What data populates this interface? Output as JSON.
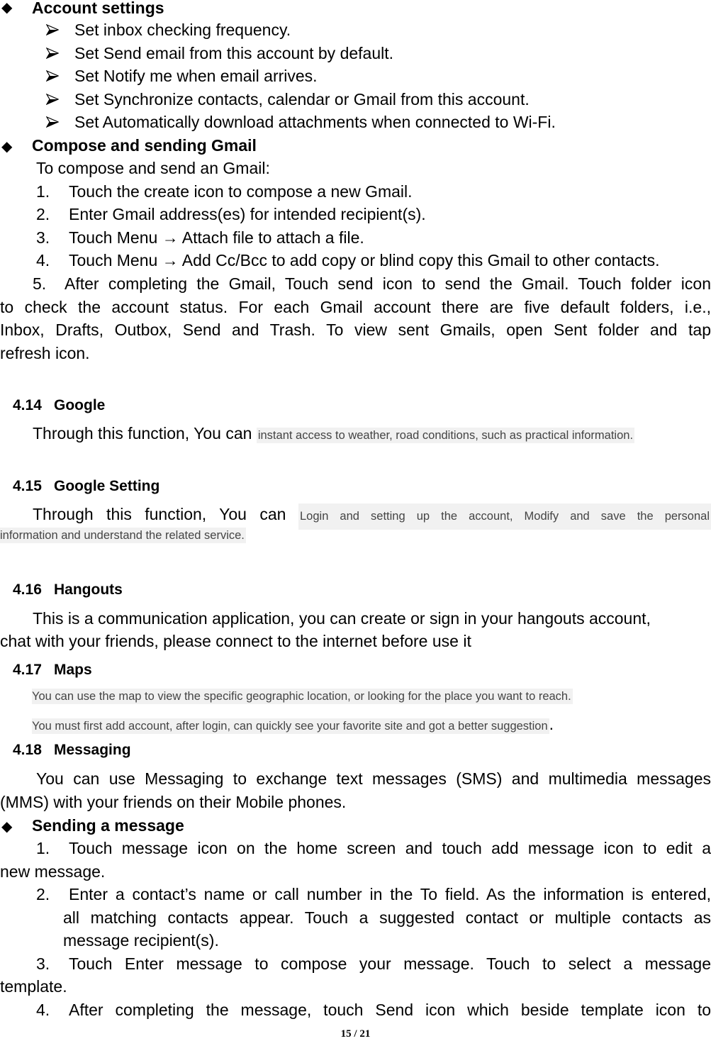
{
  "account_settings": {
    "title": "Account settings",
    "items": [
      "Set inbox checking frequency.",
      "Set Send email from this account by default.",
      "Set Notify me when email arrives.",
      "Set Synchronize contacts, calendar or Gmail from this account.",
      "Set Automatically download attachments when connected to Wi-Fi."
    ]
  },
  "compose": {
    "title": "Compose and sending Gmail",
    "intro": "To compose and send an Gmail:",
    "steps": [
      {
        "num": "1.",
        "text": "Touch the create icon to compose a new Gmail."
      },
      {
        "num": "2.",
        "text": "Enter Gmail address(es) for intended recipient(s)."
      },
      {
        "num": "3.",
        "text": "Touch Menu → Attach file to attach a file."
      },
      {
        "num": "4.",
        "text": "Touch Menu → Add Cc/Bcc to add copy or blind copy this Gmail to other contacts."
      }
    ],
    "step5": {
      "num": "5.",
      "lines": [
        "After completing the Gmail, Touch send icon to send the Gmail. Touch folder icon",
        "to check the account status. For each Gmail account there are five default folders, i.e.,",
        "Inbox, Drafts, Outbox, Send and Trash. To view sent Gmails, open Sent folder and tap",
        "refresh icon."
      ]
    }
  },
  "sections": {
    "google": {
      "number": "4.14",
      "title": "Google",
      "lead": "Through this function, You can",
      "highlight": "instant access to weather, road conditions, such as practical information."
    },
    "google_setting": {
      "number": "4.15",
      "title": "Google Setting",
      "lead": "Through this function, You can",
      "highlight_line1": "Login and setting up the account, Modify and save the personal",
      "highlight_line2": "information and understand the related service."
    },
    "hangouts": {
      "number": "4.16",
      "title": "Hangouts",
      "line1": "This is a communication application, you can create or sign in your hangouts account,",
      "line2": "chat with your friends, please connect to the internet before use it"
    },
    "maps": {
      "number": "4.17",
      "title": "Maps",
      "line1": "You can use the map to view the specific geographic location, or looking for the place you want to reach.",
      "line2": "You must first add account, after login, can quickly see your favorite site and got a better suggestion",
      "line2_end": "."
    },
    "messaging": {
      "number": "4.18",
      "title": "Messaging",
      "line1": "You can use Messaging to exchange text messages (SMS) and multimedia messages",
      "line2": "(MMS) with your friends on their Mobile phones."
    }
  },
  "sending": {
    "title": "Sending a message",
    "step1": {
      "num": "1.",
      "line1": "Touch message icon on the home screen and touch add message icon to edit a",
      "line2": "new message."
    },
    "step2": {
      "num": "2.",
      "line1": "Enter a contact’s name or call number in the To field. As the information is entered,",
      "line2": "all matching contacts appear. Touch a suggested contact or multiple contacts as",
      "line3": "message recipient(s)."
    },
    "step3": {
      "num": "3.",
      "line1": "Touch Enter message to compose your message. Touch to select a message",
      "line2": "template."
    },
    "step4": {
      "num": "4.",
      "line1": "After completing the message, touch Send icon which beside template icon to"
    }
  },
  "footer": {
    "page": "15 / 21"
  }
}
